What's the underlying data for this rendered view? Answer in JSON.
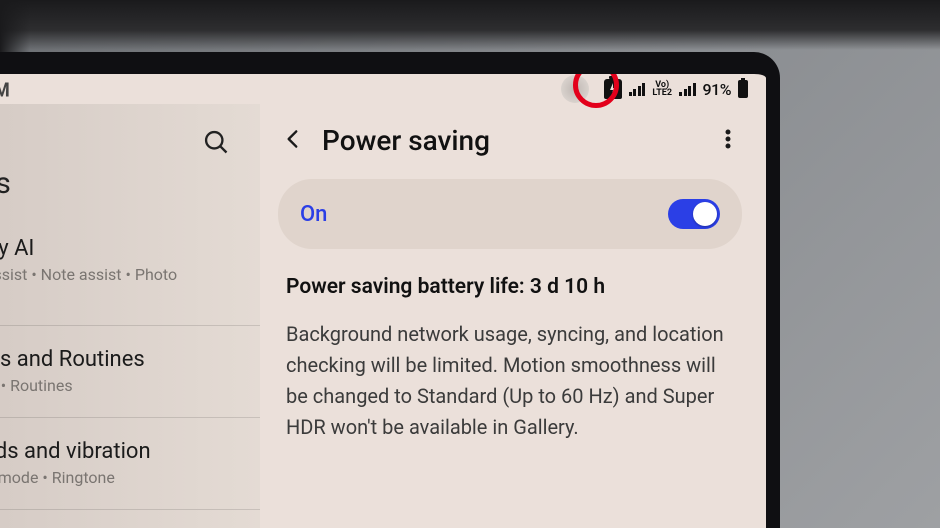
{
  "status_bar": {
    "network_label": "Vo)\nLTE2",
    "battery_percent": "91%"
  },
  "left_pane": {
    "heading": "ngs",
    "gmail_hint": "M",
    "items": [
      {
        "title": "alaxy AI",
        "sub": "nat assist  •  Note assist  •  Photo\nssist"
      },
      {
        "title": "lodes and Routines",
        "sub": "lodes  •  Routines"
      },
      {
        "title": "ounds and vibration",
        "sub": "ound mode  •  Ringtone"
      }
    ]
  },
  "right_pane": {
    "title": "Power saving",
    "toggle_label": "On",
    "battery_life_heading": "Power saving battery life: 3 d 10 h",
    "description": "Background network usage, syncing, and location checking will be limited. Motion smoothness will be changed to Standard (Up to 60 Hz) and Super HDR won't be available in Gallery."
  }
}
